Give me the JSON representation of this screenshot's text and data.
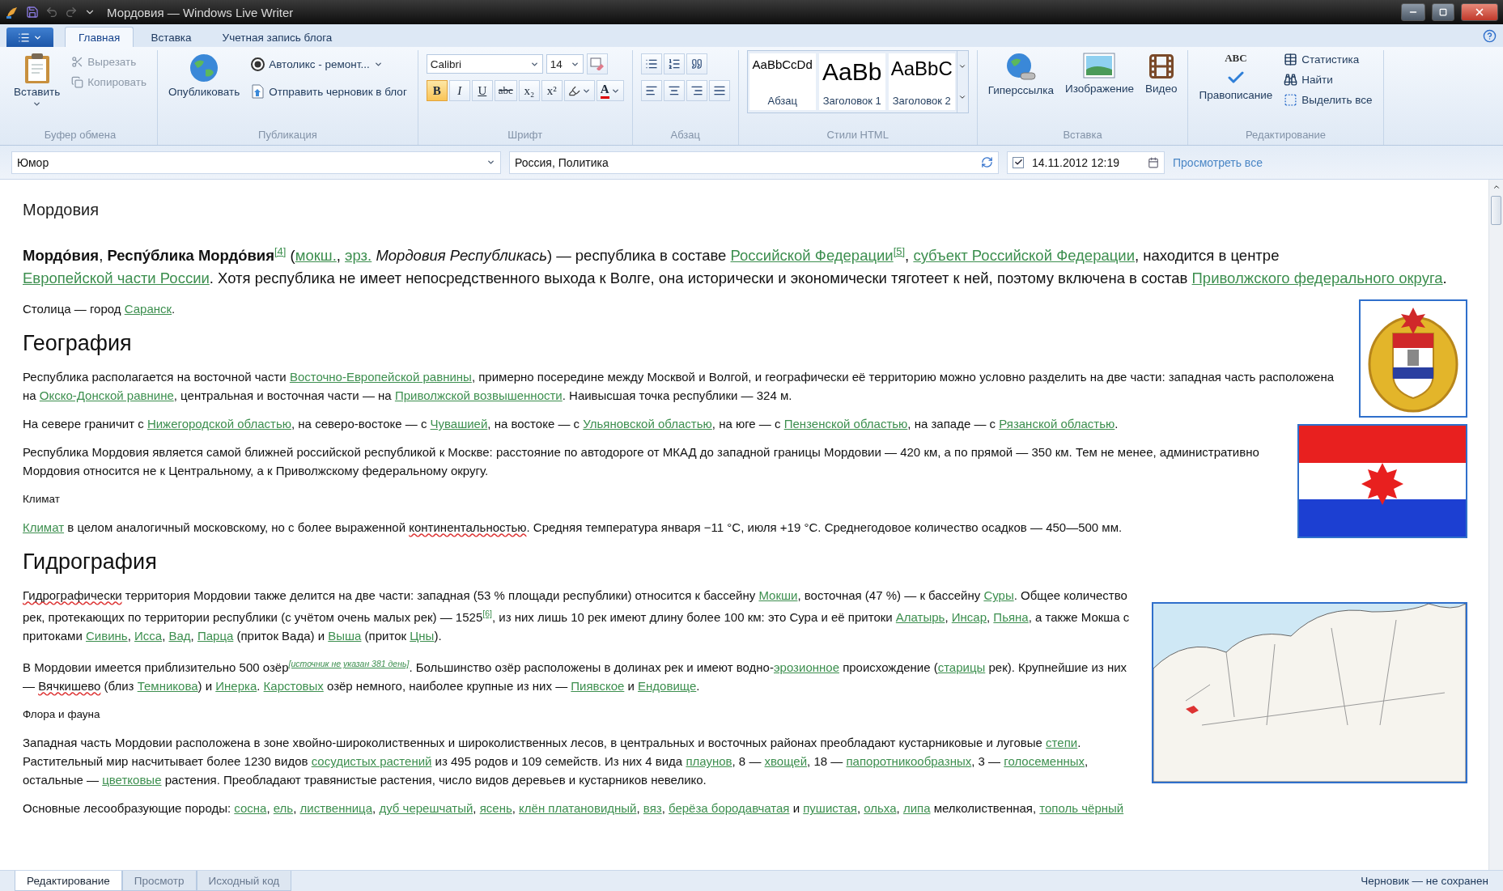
{
  "window": {
    "title": "Мордовия — Windows Live Writer"
  },
  "ribbon": {
    "tabs": [
      {
        "label": "Главная",
        "selected": true
      },
      {
        "label": "Вставка",
        "selected": false
      },
      {
        "label": "Учетная запись блога",
        "selected": false
      }
    ],
    "clipboard": {
      "label": "Буфер обмена",
      "paste": "Вставить",
      "cut": {
        "label": "Вырезать",
        "disabled": true
      },
      "copy": {
        "label": "Копировать",
        "disabled": true
      }
    },
    "publish": {
      "label": "Публикация",
      "publish": "Опубликовать",
      "blog": "Автоликс - ремонт...",
      "draft": "Отправить черновик в блог"
    },
    "font": {
      "label": "Шрифт",
      "family": "Calibri",
      "size": "14",
      "color_glyph": "A",
      "formats": [
        {
          "glyph": "B",
          "kind": "bold",
          "on": true
        },
        {
          "glyph": "I",
          "kind": "italic",
          "on": false
        },
        {
          "glyph": "U",
          "kind": "underline",
          "on": false
        },
        {
          "glyph": "abc",
          "kind": "strike",
          "on": false
        },
        {
          "glyph": "x₂",
          "kind": "sub",
          "on": false
        },
        {
          "glyph": "x²",
          "kind": "sup",
          "on": false
        }
      ]
    },
    "paragraph": {
      "label": "Абзац"
    },
    "styles": {
      "label": "Стили HTML",
      "items": [
        {
          "sample": "AaBbCcDd",
          "name": "Абзац",
          "kind": "paragraph"
        },
        {
          "sample": "AaBb",
          "name": "Заголовок 1",
          "kind": "h1"
        },
        {
          "sample": "AaBbC",
          "name": "Заголовок 2",
          "kind": "h2"
        }
      ]
    },
    "insert": {
      "label": "Вставка",
      "items": [
        {
          "label": "Гиперссылка",
          "kind": "link"
        },
        {
          "label": "Изображение",
          "kind": "image"
        },
        {
          "label": "Видео",
          "kind": "video"
        }
      ]
    },
    "editing": {
      "label": "Редактирование",
      "spelling": "Правописание",
      "spelling_glyph": "ABC",
      "items": [
        {
          "label": "Статистика",
          "kind": "stats"
        },
        {
          "label": "Найти",
          "kind": "find"
        },
        {
          "label": "Выделить все",
          "kind": "select"
        }
      ]
    }
  },
  "fields": {
    "category": "Юмор",
    "tags": "Россия, Политика",
    "date": {
      "checked": true,
      "value": "14.11.2012 12:19"
    },
    "view_all": "Просмотреть все"
  },
  "document": {
    "title": "Мордовия",
    "blocks": [
      {
        "kind": "lead",
        "segments": [
          {
            "kind": "bold",
            "text": "Мордо́вия"
          },
          {
            "kind": "text",
            "text": ", "
          },
          {
            "kind": "bold",
            "text": "Респу́блика Мордо́вия"
          },
          {
            "kind": "sup",
            "text": "[4]"
          },
          {
            "kind": "text",
            "text": " ("
          },
          {
            "kind": "link",
            "text": "мокш."
          },
          {
            "kind": "text",
            "text": ", "
          },
          {
            "kind": "link",
            "text": "эрз."
          },
          {
            "kind": "italic",
            "text": " Мордовия Республикась"
          },
          {
            "kind": "text",
            "text": ") — республика в составе "
          },
          {
            "kind": "link",
            "text": "Российской Федерации"
          },
          {
            "kind": "sup",
            "text": "[5]"
          },
          {
            "kind": "text",
            "text": ", "
          },
          {
            "kind": "link",
            "text": "субъект Российской Федерации"
          },
          {
            "kind": "text",
            "text": ", находится в центре "
          },
          {
            "kind": "link",
            "text": "Европейской части России"
          },
          {
            "kind": "text",
            "text": ". Хотя республика не имеет непосредственного выхода к Волге, она исторически и экономически тяготеет к ней, поэтому включена в состав "
          },
          {
            "kind": "link",
            "text": "Приволжского федерального округа"
          },
          {
            "kind": "text",
            "text": "."
          }
        ]
      },
      {
        "kind": "para",
        "image": {
          "kind": "emblem"
        },
        "segments": [
          {
            "kind": "text",
            "text": "Столица — город "
          },
          {
            "kind": "link",
            "text": "Саранск"
          },
          {
            "kind": "text",
            "text": "."
          }
        ]
      },
      {
        "kind": "heading",
        "text": "География"
      },
      {
        "kind": "para",
        "segments": [
          {
            "kind": "text",
            "text": "Республика располагается на восточной части "
          },
          {
            "kind": "link",
            "text": "Восточно-Европейской равнины"
          },
          {
            "kind": "text",
            "text": ", примерно посередине между Москвой и Волгой, и географически её территорию можно условно разделить на две части: западная часть расположена на "
          },
          {
            "kind": "link",
            "text": "Окско-Донской равнине"
          },
          {
            "kind": "text",
            "text": ", центральная и восточная части — на "
          },
          {
            "kind": "link",
            "text": "Приволжской возвышенности"
          },
          {
            "kind": "text",
            "text": ". Наивысшая точка республики — 324 м."
          }
        ]
      },
      {
        "kind": "para",
        "image": {
          "kind": "flag"
        },
        "segments": [
          {
            "kind": "text",
            "text": "На севере граничит с "
          },
          {
            "kind": "link",
            "text": "Нижегородской областью"
          },
          {
            "kind": "text",
            "text": ", на северо-востоке — с "
          },
          {
            "kind": "link",
            "text": "Чувашией"
          },
          {
            "kind": "text",
            "text": ", на востоке — с "
          },
          {
            "kind": "link",
            "text": "Ульяновской областью"
          },
          {
            "kind": "text",
            "text": ", на юге — с "
          },
          {
            "kind": "link",
            "text": "Пензенской областью"
          },
          {
            "kind": "text",
            "text": ", на западе — с "
          },
          {
            "kind": "link",
            "text": "Рязанской областью"
          },
          {
            "kind": "text",
            "text": "."
          }
        ]
      },
      {
        "kind": "para",
        "segments": [
          {
            "kind": "text",
            "text": "Республика Мордовия является самой ближней российской республикой к Москве: расстояние по автодороге от МКАД до западной границы Мордовии — 420 км, а по прямой — 350 км. Тем не менее, административно Мордовия относится не к Центральному, а к Приволжскому федеральному округу."
          }
        ]
      },
      {
        "kind": "subheading",
        "text": "Климат"
      },
      {
        "kind": "para",
        "segments": [
          {
            "kind": "link",
            "text": "Климат"
          },
          {
            "kind": "text",
            "text": " в целом аналогичный московскому, но с более выраженной "
          },
          {
            "kind": "spell",
            "text": "континентальностью"
          },
          {
            "kind": "text",
            "text": ". Средняя температура января −11 °C, июля +19 °C. Среднегодовое количество осадков — 450—500 мм."
          }
        ]
      },
      {
        "kind": "heading",
        "text": "Гидрография"
      },
      {
        "kind": "para",
        "image": {
          "kind": "map"
        },
        "segments": [
          {
            "kind": "spell",
            "text": "Гидрографически"
          },
          {
            "kind": "text",
            "text": " территория Мордовии также делится на две части: западная (53 % площади республики) относится к бассейну "
          },
          {
            "kind": "link",
            "text": "Мокши"
          },
          {
            "kind": "text",
            "text": ", восточная (47 %) — к бассейну "
          },
          {
            "kind": "link",
            "text": "Суры"
          },
          {
            "kind": "text",
            "text": ". Общее количество рек, протекающих по территории республики (с учётом очень малых рек) — 1525"
          },
          {
            "kind": "sup",
            "text": "[6]"
          },
          {
            "kind": "text",
            "text": ", из них лишь 10 рек имеют длину более 100 км: это Сура и её притоки "
          },
          {
            "kind": "link",
            "text": "Алатырь"
          },
          {
            "kind": "text",
            "text": ", "
          },
          {
            "kind": "link",
            "text": "Инсар"
          },
          {
            "kind": "text",
            "text": ", "
          },
          {
            "kind": "link",
            "text": "Пьяна"
          },
          {
            "kind": "text",
            "text": ", а также Мокша с притоками "
          },
          {
            "kind": "link",
            "text": "Сивинь"
          },
          {
            "kind": "text",
            "text": ", "
          },
          {
            "kind": "link",
            "text": "Исса"
          },
          {
            "kind": "text",
            "text": ", "
          },
          {
            "kind": "link",
            "text": "Вад"
          },
          {
            "kind": "text",
            "text": ", "
          },
          {
            "kind": "link",
            "text": "Парца"
          },
          {
            "kind": "text",
            "text": " (приток Вада) и "
          },
          {
            "kind": "link",
            "text": "Выша"
          },
          {
            "kind": "text",
            "text": " (приток "
          },
          {
            "kind": "link",
            "text": "Цны"
          },
          {
            "kind": "text",
            "text": ")."
          }
        ]
      },
      {
        "kind": "para",
        "segments": [
          {
            "kind": "text",
            "text": "В Мордовии имеется приблизительно 500 озёр"
          },
          {
            "kind": "supnote",
            "text": "[источник не указан 381 день]"
          },
          {
            "kind": "text",
            "text": ". Большинство озёр расположены в долинах рек и имеют водно-"
          },
          {
            "kind": "link",
            "text": "эрозионное"
          },
          {
            "kind": "text",
            "text": " происхождение ("
          },
          {
            "kind": "link",
            "text": "старицы"
          },
          {
            "kind": "text",
            "text": " рек). Крупнейшие из них — "
          },
          {
            "kind": "spell",
            "text": "Вячкишево"
          },
          {
            "kind": "text",
            "text": " (близ "
          },
          {
            "kind": "link",
            "text": "Темникова"
          },
          {
            "kind": "text",
            "text": ") и "
          },
          {
            "kind": "link",
            "text": "Инерка"
          },
          {
            "kind": "text",
            "text": ". "
          },
          {
            "kind": "link",
            "text": "Карстовых"
          },
          {
            "kind": "text",
            "text": " озёр немного, наиболее крупные из них — "
          },
          {
            "kind": "link",
            "text": "Пиявское"
          },
          {
            "kind": "text",
            "text": " и "
          },
          {
            "kind": "link",
            "text": "Ендовище"
          },
          {
            "kind": "text",
            "text": "."
          }
        ]
      },
      {
        "kind": "subheading",
        "text": "Флора и фауна"
      },
      {
        "kind": "para",
        "segments": [
          {
            "kind": "text",
            "text": "Западная часть Мордовии расположена в зоне хвойно-широколиственных и широколиственных лесов, в центральных и восточных районах преобладают кустарниковые и луговые "
          },
          {
            "kind": "link",
            "text": "степи"
          },
          {
            "kind": "text",
            "text": ". Растительный мир насчитывает более 1230 видов "
          },
          {
            "kind": "link",
            "text": "сосудистых растений"
          },
          {
            "kind": "text",
            "text": " из 495 родов и 109 семейств. Из них 4 вида "
          },
          {
            "kind": "link",
            "text": "плаунов"
          },
          {
            "kind": "text",
            "text": ", 8 — "
          },
          {
            "kind": "link",
            "text": "хвощей"
          },
          {
            "kind": "text",
            "text": ", 18 — "
          },
          {
            "kind": "link",
            "text": "папоротникообразных"
          },
          {
            "kind": "text",
            "text": ", 3 — "
          },
          {
            "kind": "link",
            "text": "голосеменных"
          },
          {
            "kind": "text",
            "text": ", остальные — "
          },
          {
            "kind": "link",
            "text": "цветковые"
          },
          {
            "kind": "text",
            "text": " растения. Преобладают травянистые растения, число видов деревьев и кустарников невелико."
          }
        ]
      },
      {
        "kind": "para",
        "segments": [
          {
            "kind": "text",
            "text": "Основные лесообразующие породы: "
          },
          {
            "kind": "link",
            "text": "сосна"
          },
          {
            "kind": "text",
            "text": ", "
          },
          {
            "kind": "link",
            "text": "ель"
          },
          {
            "kind": "text",
            "text": ", "
          },
          {
            "kind": "link",
            "text": "лиственница"
          },
          {
            "kind": "text",
            "text": ", "
          },
          {
            "kind": "link",
            "text": "дуб черешчатый"
          },
          {
            "kind": "text",
            "text": ", "
          },
          {
            "kind": "link",
            "text": "ясень"
          },
          {
            "kind": "text",
            "text": ", "
          },
          {
            "kind": "link",
            "text": "клён платановидный"
          },
          {
            "kind": "text",
            "text": ", "
          },
          {
            "kind": "link",
            "text": "вяз"
          },
          {
            "kind": "text",
            "text": ", "
          },
          {
            "kind": "link",
            "text": "берёза бородавчатая"
          },
          {
            "kind": "text",
            "text": " и "
          },
          {
            "kind": "link",
            "text": "пушистая"
          },
          {
            "kind": "text",
            "text": ", "
          },
          {
            "kind": "link",
            "text": "ольха"
          },
          {
            "kind": "text",
            "text": ", "
          },
          {
            "kind": "link",
            "text": "липа"
          },
          {
            "kind": "text",
            "text": " мелколиственная, "
          },
          {
            "kind": "link",
            "text": "тополь чёрный"
          }
        ]
      }
    ]
  },
  "view_tabs": [
    {
      "label": "Редактирование",
      "selected": true
    },
    {
      "label": "Просмотр",
      "selected": false
    },
    {
      "label": "Исходный код",
      "selected": false
    }
  ],
  "status": "Черновик — не сохранен"
}
